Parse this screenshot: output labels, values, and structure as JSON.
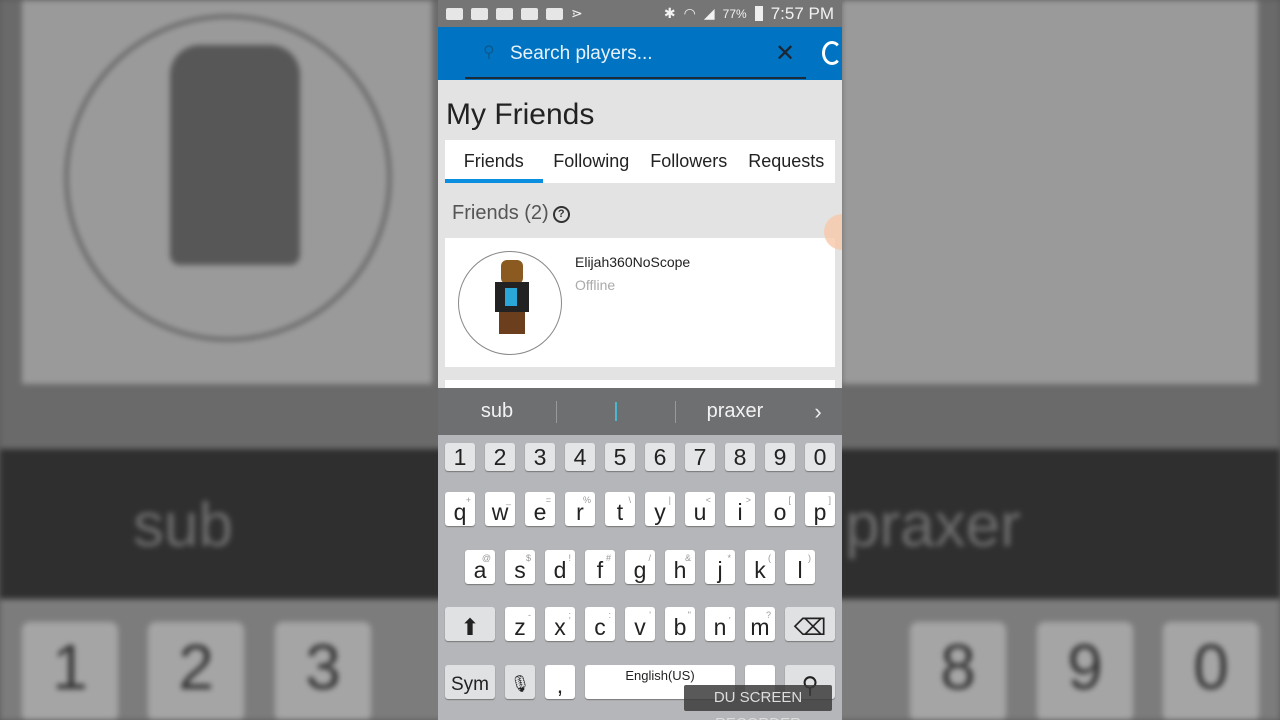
{
  "status_bar": {
    "battery": "77%",
    "time": "7:57 PM"
  },
  "search": {
    "placeholder": "Search players..."
  },
  "page_title": "My Friends",
  "tabs": [
    {
      "label": "Friends",
      "active": true
    },
    {
      "label": "Following"
    },
    {
      "label": "Followers"
    },
    {
      "label": "Requests"
    }
  ],
  "section": {
    "label": "Friends (2)",
    "help": "?"
  },
  "friends": [
    {
      "name": "Elijah360NoScope",
      "status": "Offline"
    }
  ],
  "suggestions": [
    "sub",
    "|",
    "praxer"
  ],
  "keyboard": {
    "numbers": [
      "1",
      "2",
      "3",
      "4",
      "5",
      "6",
      "7",
      "8",
      "9",
      "0"
    ],
    "row1": [
      [
        "q",
        "+"
      ],
      [
        "w",
        "_"
      ],
      [
        "e",
        "="
      ],
      [
        "r",
        "%"
      ],
      [
        "t",
        "\\"
      ],
      [
        "y",
        "|"
      ],
      [
        "u",
        "<"
      ],
      [
        "i",
        ">"
      ],
      [
        "o",
        "["
      ],
      [
        "p",
        "]"
      ]
    ],
    "row2": [
      [
        "a",
        "@"
      ],
      [
        "s",
        "$"
      ],
      [
        "d",
        "!"
      ],
      [
        "f",
        "#"
      ],
      [
        "g",
        "/"
      ],
      [
        "h",
        "&"
      ],
      [
        "j",
        "*"
      ],
      [
        "k",
        "("
      ],
      [
        "l",
        ")"
      ]
    ],
    "row3": [
      [
        "z",
        "-"
      ],
      [
        "x",
        ";"
      ],
      [
        "c",
        ":"
      ],
      [
        "v",
        "'"
      ],
      [
        "b",
        "\""
      ],
      [
        "n",
        ","
      ],
      [
        "m",
        "?"
      ]
    ],
    "sym": "Sym",
    "comma": ",",
    "space": "English(US)",
    "period": "."
  },
  "watermark": "DU SCREEN RECORDER",
  "colors": {
    "header": "#0074c2",
    "tab_indicator": "#0a8fe0"
  }
}
